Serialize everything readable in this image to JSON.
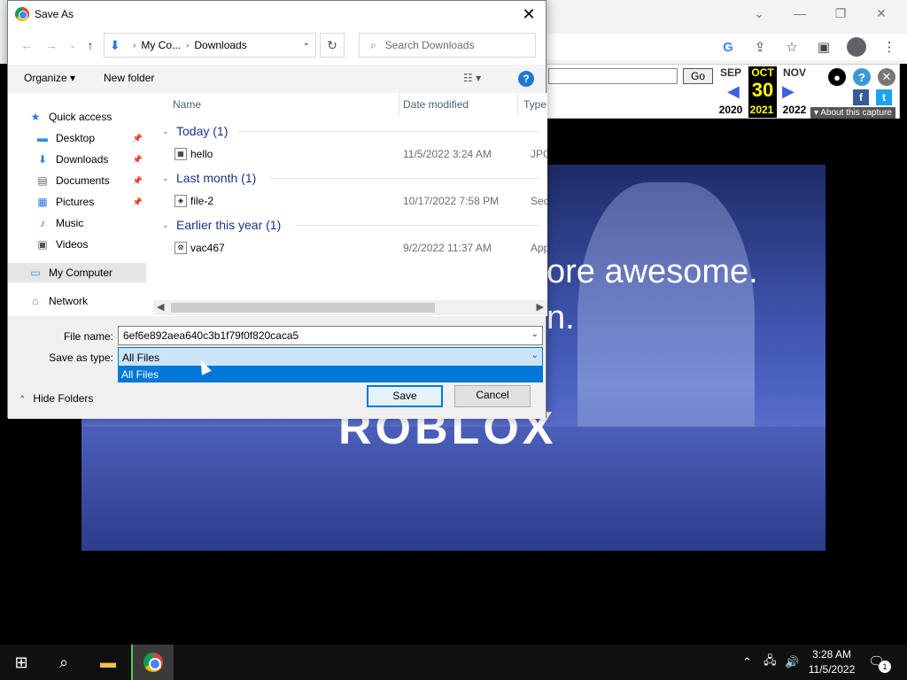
{
  "browser": {
    "window_controls": [
      "⌄",
      "—",
      "❐",
      "✕"
    ],
    "wayback": {
      "go_label": "Go",
      "prev_month": "SEP",
      "cur_month": "OCT",
      "next_month": "NOV",
      "day": "30",
      "prev_year": "2020",
      "cur_year": "2021",
      "next_year": "2022",
      "about_label": "▾ About this capture"
    }
  },
  "hero": {
    "line1": "ore awesome.",
    "line2": "n.",
    "logo": "ROBLOX"
  },
  "dialog": {
    "title": "Save As",
    "breadcrumb": [
      "My Co...",
      "Downloads"
    ],
    "search_placeholder": "Search Downloads",
    "organize_label": "Organize ▾",
    "new_folder_label": "New folder",
    "help_label": "?",
    "nav_pane": [
      {
        "label": "Quick access",
        "icon": "★"
      },
      {
        "label": "Desktop",
        "icon": "▬"
      },
      {
        "label": "Downloads",
        "icon": "⬇"
      },
      {
        "label": "Documents",
        "icon": "▤"
      },
      {
        "label": "Pictures",
        "icon": "▦"
      },
      {
        "label": "Music",
        "icon": "♪"
      },
      {
        "label": "Videos",
        "icon": "▣"
      },
      {
        "label": "My Computer",
        "icon": "▭"
      },
      {
        "label": "Network",
        "icon": "⌂"
      }
    ],
    "columns": {
      "name": "Name",
      "date": "Date modified",
      "type": "Type"
    },
    "groups": [
      {
        "label": "Today (1)",
        "files": [
          {
            "name": "hello",
            "date": "11/5/2022 3:24 AM",
            "type": "JPG F"
          }
        ]
      },
      {
        "label": "Last month (1)",
        "files": [
          {
            "name": "file-2",
            "date": "10/17/2022 7:58 PM",
            "type": "Secu"
          }
        ]
      },
      {
        "label": "Earlier this year (1)",
        "files": [
          {
            "name": "vac467",
            "date": "9/2/2022 11:37 AM",
            "type": "Appli"
          }
        ]
      }
    ],
    "file_name_label": "File name:",
    "file_name_value": "6ef6e892aea640c3b1f79f0f820caca5",
    "save_type_label": "Save as type:",
    "save_type_value": "All Files",
    "save_type_option": "All Files",
    "hide_folders_label": "Hide Folders",
    "save_button": "Save",
    "cancel_button": "Cancel"
  },
  "taskbar": {
    "time": "3:28 AM",
    "date": "11/5/2022",
    "notifications": "1"
  }
}
